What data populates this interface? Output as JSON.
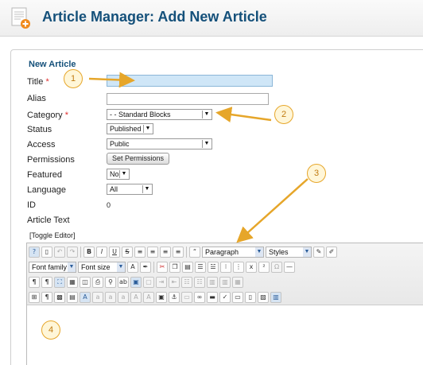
{
  "header": {
    "title": "Article Manager: Add New Article",
    "icon": "add-article-icon"
  },
  "fieldset": {
    "legend": "New Article"
  },
  "fields": {
    "title_label": "Title",
    "alias_label": "Alias",
    "category_label": "Category",
    "category_value": "- - Standard Blocks",
    "status_label": "Status",
    "status_value": "Published",
    "access_label": "Access",
    "access_value": "Public",
    "permissions_label": "Permissions",
    "permissions_button": "Set Permissions",
    "featured_label": "Featured",
    "featured_value": "No",
    "language_label": "Language",
    "language_value": "All",
    "id_label": "ID",
    "id_value": "0",
    "article_text_label": "Article Text",
    "required_mark": "*"
  },
  "editor": {
    "toggle": "[Toggle Editor]",
    "format_value": "Paragraph",
    "styles_value": "Styles",
    "font_family": "Font family",
    "font_size": "Font size",
    "bold": "B",
    "italic": "I",
    "underline": "U",
    "strike": "S"
  },
  "callouts": [
    "1",
    "2",
    "3",
    "4"
  ],
  "colors": {
    "title": "#14507a",
    "callout": "#e6a62a",
    "required": "#e03030"
  }
}
